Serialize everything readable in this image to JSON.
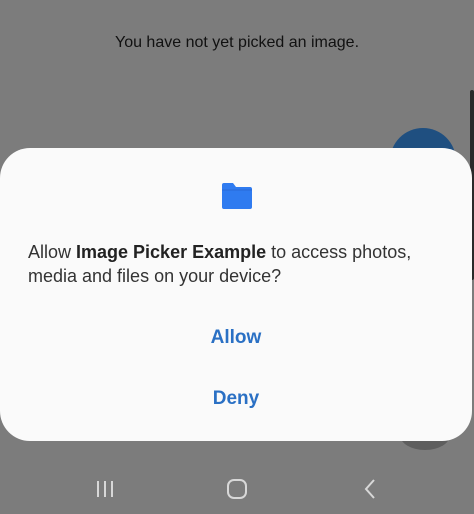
{
  "app": {
    "status_message": "You have not yet picked an image."
  },
  "dialog": {
    "icon": "folder-icon",
    "message_prefix": "Allow ",
    "app_name": "Image Picker Example",
    "message_suffix": " to access photos, media and files on your device?",
    "allow_label": "Allow",
    "deny_label": "Deny",
    "accent_color": "#2a70c4"
  },
  "nav": {
    "recents_icon": "recents-icon",
    "home_icon": "home-icon",
    "back_icon": "back-icon"
  }
}
